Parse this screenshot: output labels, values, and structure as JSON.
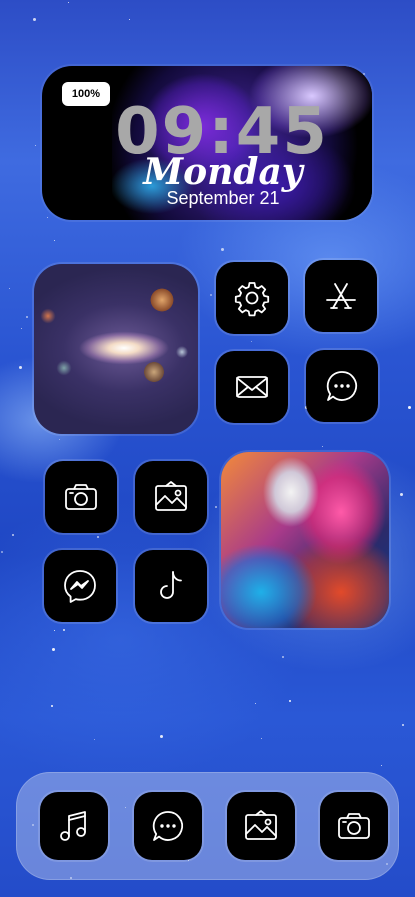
{
  "status": {
    "battery": "100%"
  },
  "widget": {
    "time": "09:45",
    "day": "Monday",
    "date": "September 21"
  },
  "apps": {
    "settings": "gear-icon",
    "app_store": "app-store-icon",
    "mail": "mail-icon",
    "messages": "message-icon",
    "camera": "camera-icon",
    "photos": "photos-icon",
    "messenger": "messenger-icon",
    "tiktok": "tiktok-icon"
  },
  "dock": [
    "music-icon",
    "message-icon",
    "photos-icon",
    "camera-icon"
  ],
  "colors": {
    "background": "#2d4dc6",
    "tile": "#000000",
    "icon_stroke": "#ffffff"
  }
}
